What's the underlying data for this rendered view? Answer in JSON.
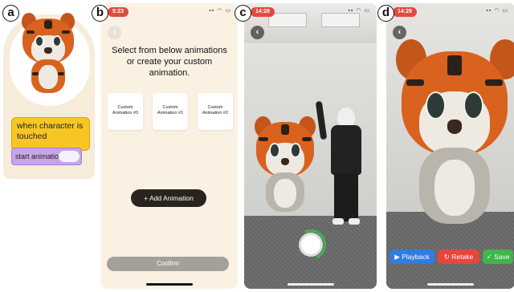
{
  "panels": {
    "a": {
      "label": "a"
    },
    "b": {
      "label": "b"
    },
    "c": {
      "label": "c"
    },
    "d": {
      "label": "d"
    }
  },
  "blocks": {
    "when_text": "when character is touched",
    "start_text": "start animation"
  },
  "screen_b": {
    "time": "5:23",
    "title": "Select from below animations or create your custom animation.",
    "cards": [
      "Custom Animation #0",
      "Custom Animation #1",
      "Custom Animation #2"
    ],
    "add_label": "Add Animation",
    "add_icon": "+",
    "confirm_label": "Confirm",
    "back_icon": "‹"
  },
  "screen_c": {
    "time": "14:28",
    "back_icon": "‹"
  },
  "screen_d": {
    "time": "14:29",
    "back_icon": "‹",
    "buttons": {
      "playback": "Playback",
      "retake": "Retake",
      "save": "Save"
    },
    "icons": {
      "playback": "▶",
      "retake": "↻",
      "save": "✓"
    }
  },
  "colors": {
    "status_red": "#e34a3f",
    "playback": "#2f7de1",
    "retake": "#e8453c",
    "save": "#3fb54a"
  }
}
